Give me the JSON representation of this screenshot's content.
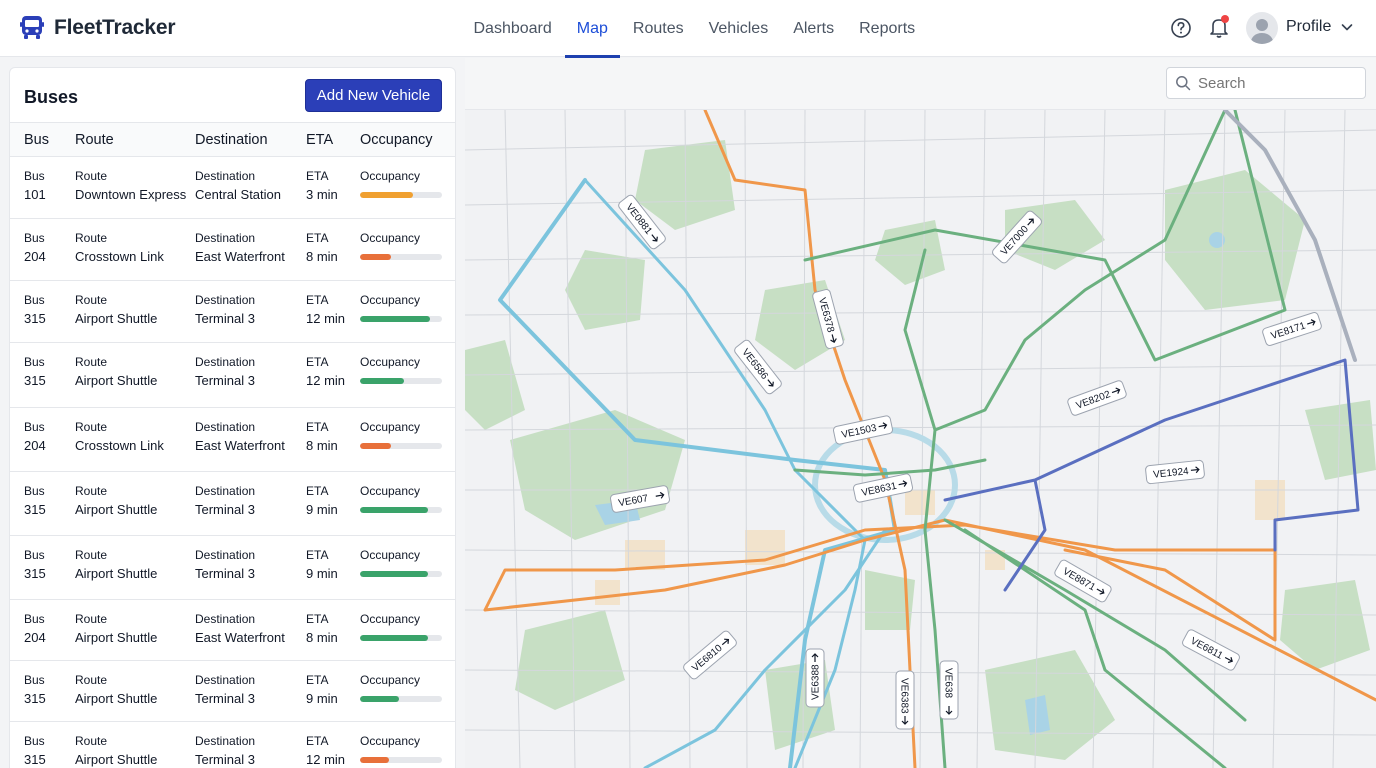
{
  "app": {
    "name": "FleetTracker",
    "logo_icon": "bus-icon"
  },
  "nav": {
    "items": [
      {
        "label": "Dashboard",
        "active": false
      },
      {
        "label": "Map",
        "active": true
      },
      {
        "label": "Routes",
        "active": false
      },
      {
        "label": "Vehicles",
        "active": false
      },
      {
        "label": "Alerts",
        "active": false
      },
      {
        "label": "Reports",
        "active": false
      }
    ]
  },
  "header": {
    "help_icon": "question-circle-icon",
    "bell_icon": "bell-icon",
    "notification_dot_color": "#ef4444",
    "profile_label": "Profile"
  },
  "panel": {
    "title": "Buses",
    "add_button": "Add New Vehicle",
    "columns": [
      "Bus",
      "Route",
      "Destination",
      "ETA",
      "Occupancy"
    ],
    "cell_labels": {
      "bus": "Bus",
      "route": "Route",
      "destination": "Destination",
      "eta": "ETA",
      "occupancy": "Occupancy"
    },
    "rows": [
      {
        "bus": "101",
        "route": "Downtown Express",
        "destination": "Central Station",
        "eta": "3 min",
        "occupancy": 0.65,
        "color": "#f0a030"
      },
      {
        "bus": "204",
        "route": "Crosstown Link",
        "destination": "East Waterfront",
        "eta": "8 min",
        "occupancy": 0.38,
        "color": "#e8703a"
      },
      {
        "bus": "315",
        "route": "Airport Shuttle",
        "destination": "Terminal 3",
        "eta": "12 min",
        "occupancy": 0.85,
        "color": "#3aa36a"
      },
      {
        "bus": "315",
        "route": "Airport Shuttle",
        "destination": "Terminal 3",
        "eta": "12 min",
        "occupancy": 0.54,
        "color": "#3aa36a"
      },
      {
        "bus": "204",
        "route": "Crosstown Link",
        "destination": "East Waterfront",
        "eta": "8 min",
        "occupancy": 0.38,
        "color": "#e8703a"
      },
      {
        "bus": "315",
        "route": "Airport Shuttle",
        "destination": "Terminal 3",
        "eta": "9 min",
        "occupancy": 0.83,
        "color": "#3aa36a"
      },
      {
        "bus": "315",
        "route": "Airport Shuttle",
        "destination": "Terminal 3",
        "eta": "9 min",
        "occupancy": 0.83,
        "color": "#3aa36a"
      },
      {
        "bus": "204",
        "route": "Airport Shuttle",
        "destination": "East Waterfront",
        "eta": "8 min",
        "occupancy": 0.83,
        "color": "#3aa36a"
      },
      {
        "bus": "315",
        "route": "Airport Shuttle",
        "destination": "Terminal 3",
        "eta": "9 min",
        "occupancy": 0.48,
        "color": "#3aa36a"
      },
      {
        "bus": "315",
        "route": "Airport Shuttle",
        "destination": "Terminal 3",
        "eta": "12 min",
        "occupancy": 0.35,
        "color": "#e8703a"
      }
    ]
  },
  "map": {
    "search_placeholder": "Search",
    "route_colors": {
      "orange": "#f0974a",
      "blue": "#7cc4dd",
      "green": "#6bb07f",
      "navy": "#5a6fc0",
      "gray": "#a9b0bd"
    },
    "vehicle_tags": [
      "VE0881",
      "VE6378",
      "VE6586",
      "VE7000",
      "VE8171",
      "VE8202",
      "VE1503",
      "VE1924",
      "VE8631",
      "VE607",
      "VE8871",
      "VE6811",
      "VE6810",
      "VE6388",
      "VE6383",
      "VE638"
    ]
  }
}
